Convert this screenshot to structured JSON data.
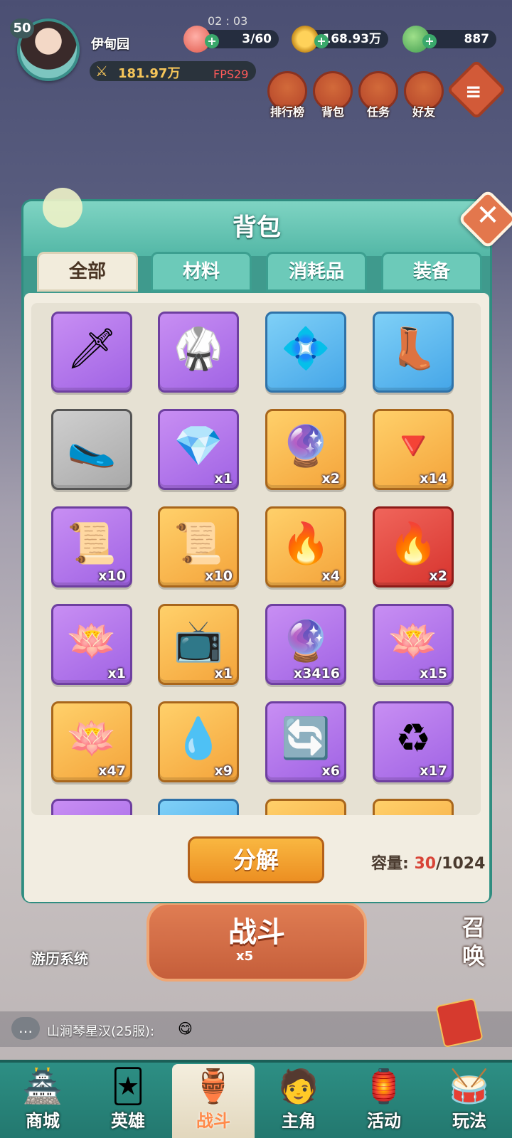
{
  "hud": {
    "level": "50",
    "player_name": "伊甸园",
    "power": "181.97万",
    "fps": "FPS29",
    "time": "02 : 03",
    "stamina": "3/60",
    "coins": "168.93万",
    "jade": "887"
  },
  "top_menu": [
    {
      "label": "排行榜",
      "icon": "ranking-icon"
    },
    {
      "label": "背包",
      "icon": "bag-icon"
    },
    {
      "label": "任务",
      "icon": "task-icon"
    },
    {
      "label": "好友",
      "icon": "friends-icon"
    }
  ],
  "dialog": {
    "title": "背包",
    "close_icon": "close-icon",
    "tabs": [
      {
        "label": "全部",
        "active": true
      },
      {
        "label": "材料",
        "active": false
      },
      {
        "label": "消耗品",
        "active": false
      },
      {
        "label": "装备",
        "active": false
      }
    ],
    "items": [
      {
        "name": "sword",
        "rarity": "purple",
        "qty": "",
        "glyph": "🗡"
      },
      {
        "name": "armor",
        "rarity": "purple",
        "qty": "",
        "glyph": "🥋"
      },
      {
        "name": "amulet",
        "rarity": "blue",
        "qty": "",
        "glyph": "💠"
      },
      {
        "name": "boots-blue",
        "rarity": "blue",
        "qty": "",
        "glyph": "👢"
      },
      {
        "name": "boots-gray",
        "rarity": "gray",
        "qty": "",
        "glyph": "🥿"
      },
      {
        "name": "green-crystal",
        "rarity": "purple",
        "qty": "x1",
        "glyph": "💎"
      },
      {
        "name": "rainbow-crystal",
        "rarity": "gold",
        "qty": "x2",
        "glyph": "🔮"
      },
      {
        "name": "red-crystal",
        "rarity": "gold",
        "qty": "x14",
        "glyph": "🔻"
      },
      {
        "name": "purple-scroll",
        "rarity": "purple",
        "qty": "x10",
        "glyph": "📜"
      },
      {
        "name": "gold-scroll",
        "rarity": "gold",
        "qty": "x10",
        "glyph": "📜"
      },
      {
        "name": "blue-flame",
        "rarity": "gold",
        "qty": "x4",
        "glyph": "🔥"
      },
      {
        "name": "purple-flame",
        "rarity": "red",
        "qty": "x2",
        "glyph": "🔥"
      },
      {
        "name": "white-lotus",
        "rarity": "purple",
        "qty": "x1",
        "glyph": "🪷"
      },
      {
        "name": "ad-ticket",
        "rarity": "gold",
        "qty": "x1",
        "glyph": "📺"
      },
      {
        "name": "crystal-ball",
        "rarity": "purple",
        "qty": "x3416",
        "glyph": "🔮"
      },
      {
        "name": "golden-lotus-purple",
        "rarity": "purple",
        "qty": "x15",
        "glyph": "🪷"
      },
      {
        "name": "golden-lotus",
        "rarity": "gold",
        "qty": "x47",
        "glyph": "🪷"
      },
      {
        "name": "water-lotus",
        "rarity": "gold",
        "qty": "x9",
        "glyph": "💧"
      },
      {
        "name": "reset-board",
        "rarity": "purple",
        "qty": "x6",
        "glyph": "🔄"
      },
      {
        "name": "refresh-arrows",
        "rarity": "purple",
        "qty": "x17",
        "glyph": "♻"
      }
    ],
    "decompose_label": "分解",
    "capacity_label": "容量:",
    "capacity_current": "30",
    "capacity_max": "/1024"
  },
  "background": {
    "battle_label": "战斗",
    "battle_cost": "x5",
    "travel_label": "游历系统",
    "summon_label": "召唤"
  },
  "chat": {
    "message": "山涧琴星汉(25服):",
    "emoji": "😋"
  },
  "bottom_nav": [
    {
      "label": "商城",
      "icon": "shop-icon",
      "glyph": "🏯",
      "active": false
    },
    {
      "label": "英雄",
      "icon": "hero-cards-icon",
      "glyph": "🃏",
      "active": false
    },
    {
      "label": "战斗",
      "icon": "battle-icon",
      "glyph": "🏺",
      "active": true
    },
    {
      "label": "主角",
      "icon": "protagonist-icon",
      "glyph": "🧑",
      "active": false
    },
    {
      "label": "活动",
      "icon": "event-icon",
      "glyph": "🏮",
      "active": false
    },
    {
      "label": "玩法",
      "icon": "gameplay-icon",
      "glyph": "🥁",
      "active": false
    }
  ],
  "colors": {
    "accent": "#53b7a6",
    "capacity_current": "#d84437",
    "active_tab": "#f2ecdc"
  }
}
